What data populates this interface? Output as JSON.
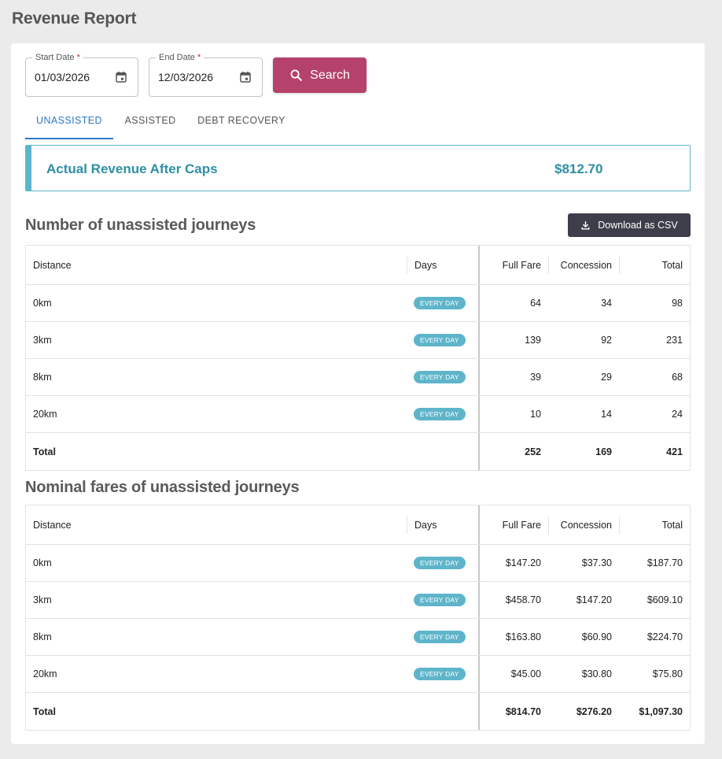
{
  "page": {
    "title": "Revenue Report"
  },
  "filters": {
    "start_label": "Start Date",
    "start_value": "01/03/2026",
    "end_label": "End Date",
    "end_value": "12/03/2026",
    "required_mark": "*",
    "search_label": "Search"
  },
  "tabs": [
    {
      "label": "UNASSISTED",
      "active": true
    },
    {
      "label": "ASSISTED",
      "active": false
    },
    {
      "label": "DEBT RECOVERY",
      "active": false
    }
  ],
  "banner": {
    "label": "Actual Revenue After Caps",
    "value": "$812.70"
  },
  "journeys": {
    "title": "Number of unassisted journeys",
    "download_label": "Download as CSV",
    "headers": {
      "distance": "Distance",
      "days": "Days",
      "full_fare": "Full Fare",
      "concession": "Concession",
      "total": "Total"
    },
    "rows": [
      {
        "distance": "0km",
        "days": "EVERY DAY",
        "full_fare": "64",
        "concession": "34",
        "total": "98"
      },
      {
        "distance": "3km",
        "days": "EVERY DAY",
        "full_fare": "139",
        "concession": "92",
        "total": "231"
      },
      {
        "distance": "8km",
        "days": "EVERY DAY",
        "full_fare": "39",
        "concession": "29",
        "total": "68"
      },
      {
        "distance": "20km",
        "days": "EVERY DAY",
        "full_fare": "10",
        "concession": "14",
        "total": "24"
      }
    ],
    "totals": {
      "label": "Total",
      "full_fare": "252",
      "concession": "169",
      "total": "421"
    }
  },
  "fares": {
    "title": "Nominal fares of unassisted journeys",
    "headers": {
      "distance": "Distance",
      "days": "Days",
      "full_fare": "Full Fare",
      "concession": "Concession",
      "total": "Total"
    },
    "rows": [
      {
        "distance": "0km",
        "days": "EVERY DAY",
        "full_fare": "$147.20",
        "concession": "$37.30",
        "total": "$187.70"
      },
      {
        "distance": "3km",
        "days": "EVERY DAY",
        "full_fare": "$458.70",
        "concession": "$147.20",
        "total": "$609.10"
      },
      {
        "distance": "8km",
        "days": "EVERY DAY",
        "full_fare": "$163.80",
        "concession": "$60.90",
        "total": "$224.70"
      },
      {
        "distance": "20km",
        "days": "EVERY DAY",
        "full_fare": "$45.00",
        "concession": "$30.80",
        "total": "$75.80"
      }
    ],
    "totals": {
      "label": "Total",
      "full_fare": "$814.70",
      "concession": "$276.20",
      "total": "$1,097.30"
    }
  },
  "colors": {
    "accent": "#b5426b",
    "tab_active": "#2f79c2",
    "teal": "#5eb5ca",
    "teal_text": "#2e8fa4",
    "dark_button": "#3e3e4a"
  },
  "icons": {
    "calendar": "calendar-icon",
    "search": "search-icon",
    "download": "download-icon"
  }
}
